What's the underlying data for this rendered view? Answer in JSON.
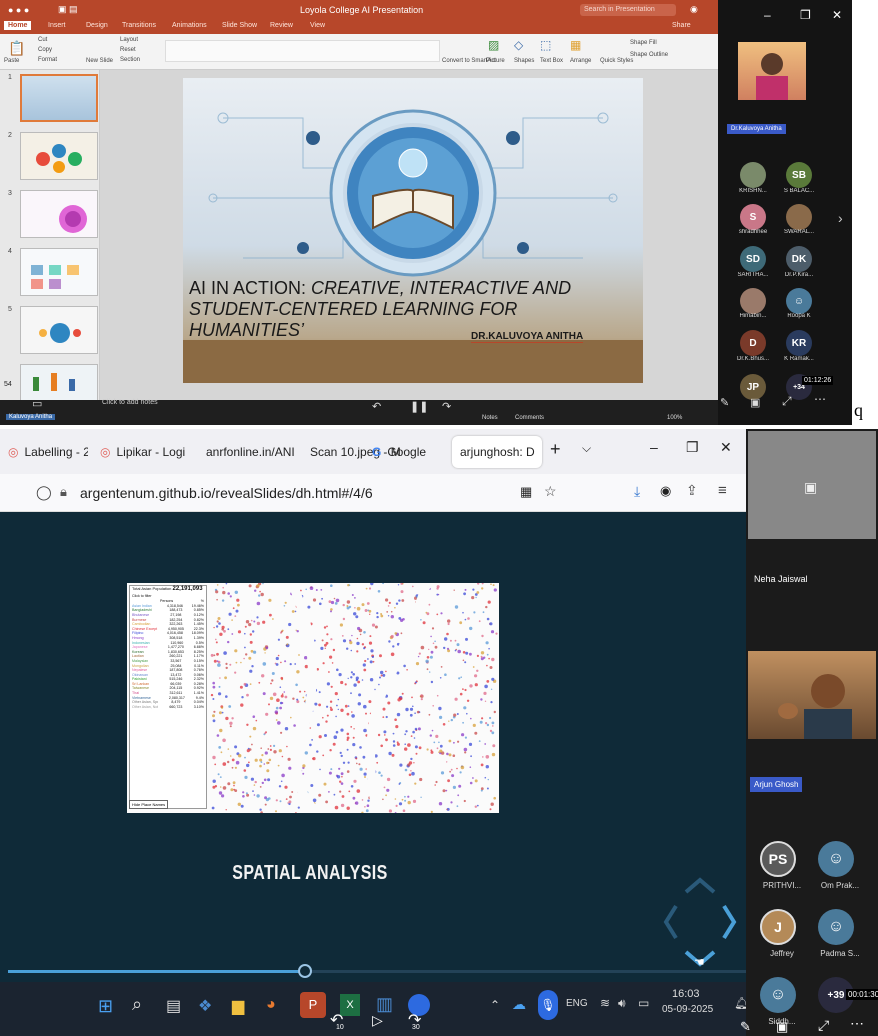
{
  "ppt": {
    "title": "Loyola College AI Presentation",
    "search_placeholder": "Search in Presentation",
    "share": "Share",
    "tabs": [
      "Home",
      "Insert",
      "Design",
      "Transitions",
      "Animations",
      "Slide Show",
      "Review",
      "View"
    ],
    "clipboard": [
      "Cut",
      "Copy",
      "Format",
      "Paste"
    ],
    "ribbon_items": [
      "Layout",
      "Reset",
      "Section",
      "New Slide",
      "Picture",
      "Shapes",
      "Text Box",
      "Arrange",
      "Quick Styles",
      "Shape Fill",
      "Shape Outline",
      "Convert to SmartArt"
    ],
    "slide_numbers": [
      "1",
      "2",
      "3",
      "4",
      "5"
    ],
    "slide_title_1": "AI IN ACTION: ",
    "slide_title_1b": "CREATIVE, INTERACTIVE AND",
    "slide_title_2": "STUDENT-CENTERED LEARNING FOR",
    "slide_title_3": "HUMANITIES’",
    "slide_author": "DR.KALUVOYA ANITHA",
    "notes_placeholder": "Click to add notes",
    "slide_count": "54",
    "status_left": "Kaluvoya Anitha",
    "status_notes": "Notes",
    "status_comments": "Comments",
    "zoom": "100%"
  },
  "meet_top": {
    "presenter": "Dr.Kaluvoya Anitha",
    "participants": [
      {
        "initials": "",
        "name": "KRISHN..."
      },
      {
        "initials": "SB",
        "name": "S BALAC..."
      },
      {
        "initials": "S",
        "name": "shradhhee"
      },
      {
        "initials": "",
        "name": "SWARAL..."
      },
      {
        "initials": "SD",
        "name": "SARITHA..."
      },
      {
        "initials": "DK",
        "name": "Dr.P.Kira..."
      },
      {
        "initials": "",
        "name": "Himabin..."
      },
      {
        "initials": "",
        "name": "Roopa K"
      },
      {
        "initials": "D",
        "name": "Dr.K.Bhus..."
      },
      {
        "initials": "KR",
        "name": "K Ramak..."
      },
      {
        "initials": "JP",
        "name": "Jyoti..."
      },
      {
        "initials": "+34",
        "name": ""
      }
    ],
    "timer": "01:12:26",
    "stray_char": "q"
  },
  "browser": {
    "tabs": [
      "Labelling - 2",
      "Lipikar - Logi",
      "anrfonline.in/ANI",
      "Scan 10.jpeg - M",
      "Google",
      "arjunghosh: D"
    ],
    "url": "argentenum.github.io/revealSlides/dh.html#/4/6",
    "slide_heading": "SPATIAL ANALYSIS",
    "map": {
      "total_label": "Total Asian Population",
      "total_value": "22,191,093",
      "filter": "Click to filter",
      "col_persons": "Persons",
      "col_pct": "%",
      "button": "Hide Place Names",
      "rows": [
        [
          "Asian Indian",
          "4,318,546",
          "19.46%"
        ],
        [
          "Bangladeshi",
          "188,473",
          "0.85%"
        ],
        [
          "Bhutanese",
          "27,198",
          "0.12%"
        ],
        [
          "Burmese",
          "182,254",
          "0.82%"
        ],
        [
          "Cambodian",
          "322,263",
          "1.45%"
        ],
        [
          "Chinese Except Taiwanese",
          "4,950,905",
          "22.3%"
        ],
        [
          "Filipino",
          "4,016,458",
          "18.09%"
        ],
        [
          "Hmong",
          "308,518",
          "1.39%"
        ],
        [
          "Indonesian",
          "110,960",
          "0.5%"
        ],
        [
          "Japanese",
          "1,477,270",
          "6.66%"
        ],
        [
          "Korean",
          "1,830,653",
          "8.25%"
        ],
        [
          "Laotian",
          "260,221",
          "1.17%"
        ],
        [
          "Malaysian",
          "33,567",
          "0.15%"
        ],
        [
          "Mongolian",
          "25,084",
          "0.11%"
        ],
        [
          "Nepalese",
          "187,808",
          "0.76%"
        ],
        [
          "Okinawan",
          "13,472",
          "0.06%"
        ],
        [
          "Pakistani",
          "515,246",
          "2.32%"
        ],
        [
          "Sri Lankan",
          "66,039",
          "0.28%"
        ],
        [
          "Taiwanese",
          "204,115",
          "0.92%"
        ],
        [
          "Thai",
          "312,611",
          "1.41%"
        ],
        [
          "Vietnamese",
          "2,080,317",
          "9.4%"
        ],
        [
          "Other Asian, Specified",
          "8,479",
          "0.04%"
        ],
        [
          "Other Asian, Not Specified",
          "660,723",
          "3.10%"
        ]
      ]
    }
  },
  "taskbar": {
    "lang": "ENG",
    "time": "16:03",
    "date": "05-09-2025"
  },
  "meet_bottom": {
    "participants": [
      {
        "initials": "",
        "name": "Neha Jaiswal"
      },
      {
        "initials": "",
        "name": "Arjun Ghosh"
      },
      {
        "initials": "PS",
        "name": "PRITHVI..."
      },
      {
        "initials": "",
        "name": "Om Prak..."
      },
      {
        "initials": "J",
        "name": "Jeffrey"
      },
      {
        "initials": "",
        "name": "Padma S..."
      },
      {
        "initials": "",
        "name": "Siddh..."
      },
      {
        "initials": "+39",
        "name": ""
      }
    ],
    "timer": "00:01:30",
    "rewind": "10",
    "forward": "30"
  },
  "colors": {
    "ppt_red": "#b7472a",
    "slide_bg": "#0f2a38",
    "sb_green": "#5a7a3a",
    "s_pink": "#c97788",
    "sd_teal": "#3e6a78",
    "dk_gray": "#4d5d6a",
    "d_brown": "#7a3a2a",
    "kr_navy": "#2a3b5e",
    "jp_brown": "#6a5a3a",
    "ps_gray": "#5a5a5a",
    "j_tan": "#b48a58",
    "person_blue": "#4a7a9a"
  }
}
